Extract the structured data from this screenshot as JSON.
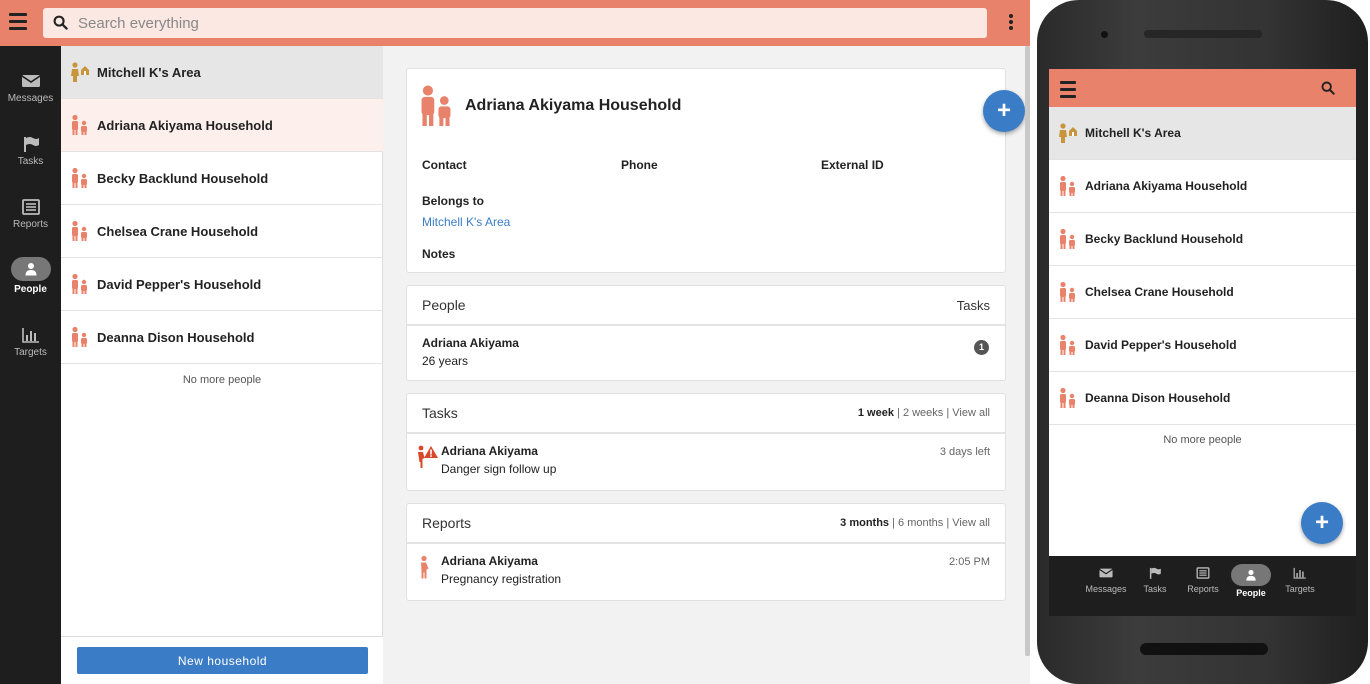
{
  "search": {
    "placeholder": "Search everything"
  },
  "nav": [
    {
      "label": "Messages",
      "icon": "envelope-icon"
    },
    {
      "label": "Tasks",
      "icon": "flag-icon"
    },
    {
      "label": "Reports",
      "icon": "list-icon"
    },
    {
      "label": "People",
      "icon": "person-icon",
      "active": true
    },
    {
      "label": "Targets",
      "icon": "bar-chart-icon"
    }
  ],
  "list": {
    "area": "Mitchell K's Area",
    "households": [
      "Adriana Akiyama Household",
      "Becky Backlund Household",
      "Chelsea Crane Household",
      "David Pepper's Household",
      "Deanna Dison Household"
    ],
    "no_more": "No more people",
    "new_button": "New household"
  },
  "detail": {
    "title": "Adriana Akiyama Household",
    "fields": {
      "contact": "Contact",
      "phone": "Phone",
      "external_id": "External ID",
      "belongs_to": "Belongs to",
      "belongs_to_value": "Mitchell K's Area",
      "notes": "Notes"
    },
    "fab": "+",
    "people": {
      "title": "People",
      "tasks_label": "Tasks",
      "rows": [
        {
          "name": "Adriana Akiyama",
          "age": "26 years",
          "badge": "1"
        }
      ]
    },
    "tasks": {
      "title": "Tasks",
      "filter_active": "1 week",
      "filter_2": "2 weeks",
      "filter_3": "View all",
      "sep": "|",
      "rows": [
        {
          "name": "Adriana Akiyama",
          "desc": "Danger sign follow up",
          "due": "3 days left"
        }
      ]
    },
    "reports": {
      "title": "Reports",
      "filter_active": "3 months",
      "filter_2": "6 months",
      "filter_3": "View all",
      "sep": "|",
      "rows": [
        {
          "name": "Adriana Akiyama",
          "desc": "Pregnancy registration",
          "time": "2:05 PM"
        }
      ]
    }
  },
  "colors": {
    "brand": "#e8826a",
    "accent": "#3b7cc6",
    "household_icon": "#e8826a",
    "area_icon": "#c9953a",
    "danger": "#d9482b"
  }
}
